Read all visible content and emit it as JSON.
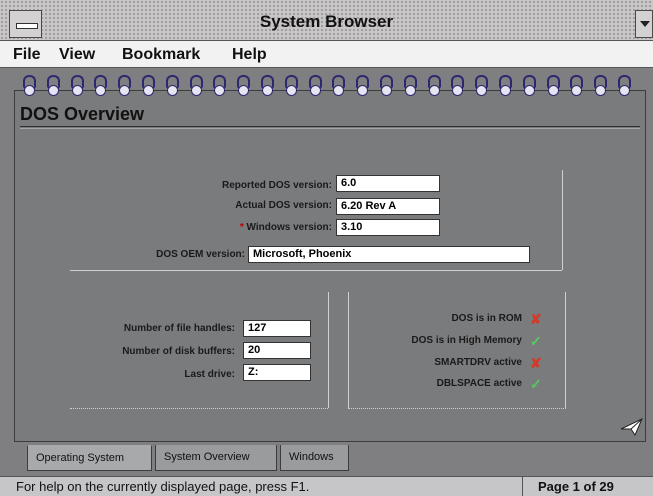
{
  "window": {
    "title": "System Browser"
  },
  "menu": {
    "file": "File",
    "view": "View",
    "bookmark": "Bookmark",
    "help": "Help"
  },
  "page": {
    "title": "DOS Overview"
  },
  "dos_info": {
    "reported_label": "Reported DOS version:",
    "reported_value": "6.0",
    "actual_label": "Actual DOS version:",
    "actual_value": "6.20 Rev A",
    "windows_star": "*",
    "windows_label": "Windows version:",
    "windows_value": "3.10",
    "oem_label": "DOS OEM version:",
    "oem_value": "Microsoft, Phoenix"
  },
  "system_info": {
    "file_handles_label": "Number of file handles:",
    "file_handles_value": "127",
    "disk_buffers_label": "Number of disk buffers:",
    "disk_buffers_value": "20",
    "last_drive_label": "Last drive:",
    "last_drive_value": "Z:"
  },
  "status_items": [
    {
      "label": "DOS is in ROM",
      "state": "no",
      "mark": "✘",
      "color": "#d23a2a"
    },
    {
      "label": "DOS is in High Memory",
      "state": "yes",
      "mark": "✓",
      "color": "#58c95e"
    },
    {
      "label": "SMARTDRV active",
      "state": "no",
      "mark": "✘",
      "color": "#d23a2a"
    },
    {
      "label": "DBLSPACE active",
      "state": "yes",
      "mark": "✓",
      "color": "#58c95e"
    }
  ],
  "tabs": [
    {
      "label": "Operating System",
      "active": true
    },
    {
      "label": "System Overview",
      "active": false
    },
    {
      "label": "Windows",
      "active": false
    }
  ],
  "statusbar": {
    "help_text": "For help on the currently displayed page, press F1.",
    "page_indicator": "Page 1 of 29"
  },
  "icons": {
    "system_menu": "system-menu-icon",
    "dropdown": "chevron-down-icon",
    "binder_rings": "binder-ring-icon",
    "page_turn": "paper-airplane-icon"
  }
}
